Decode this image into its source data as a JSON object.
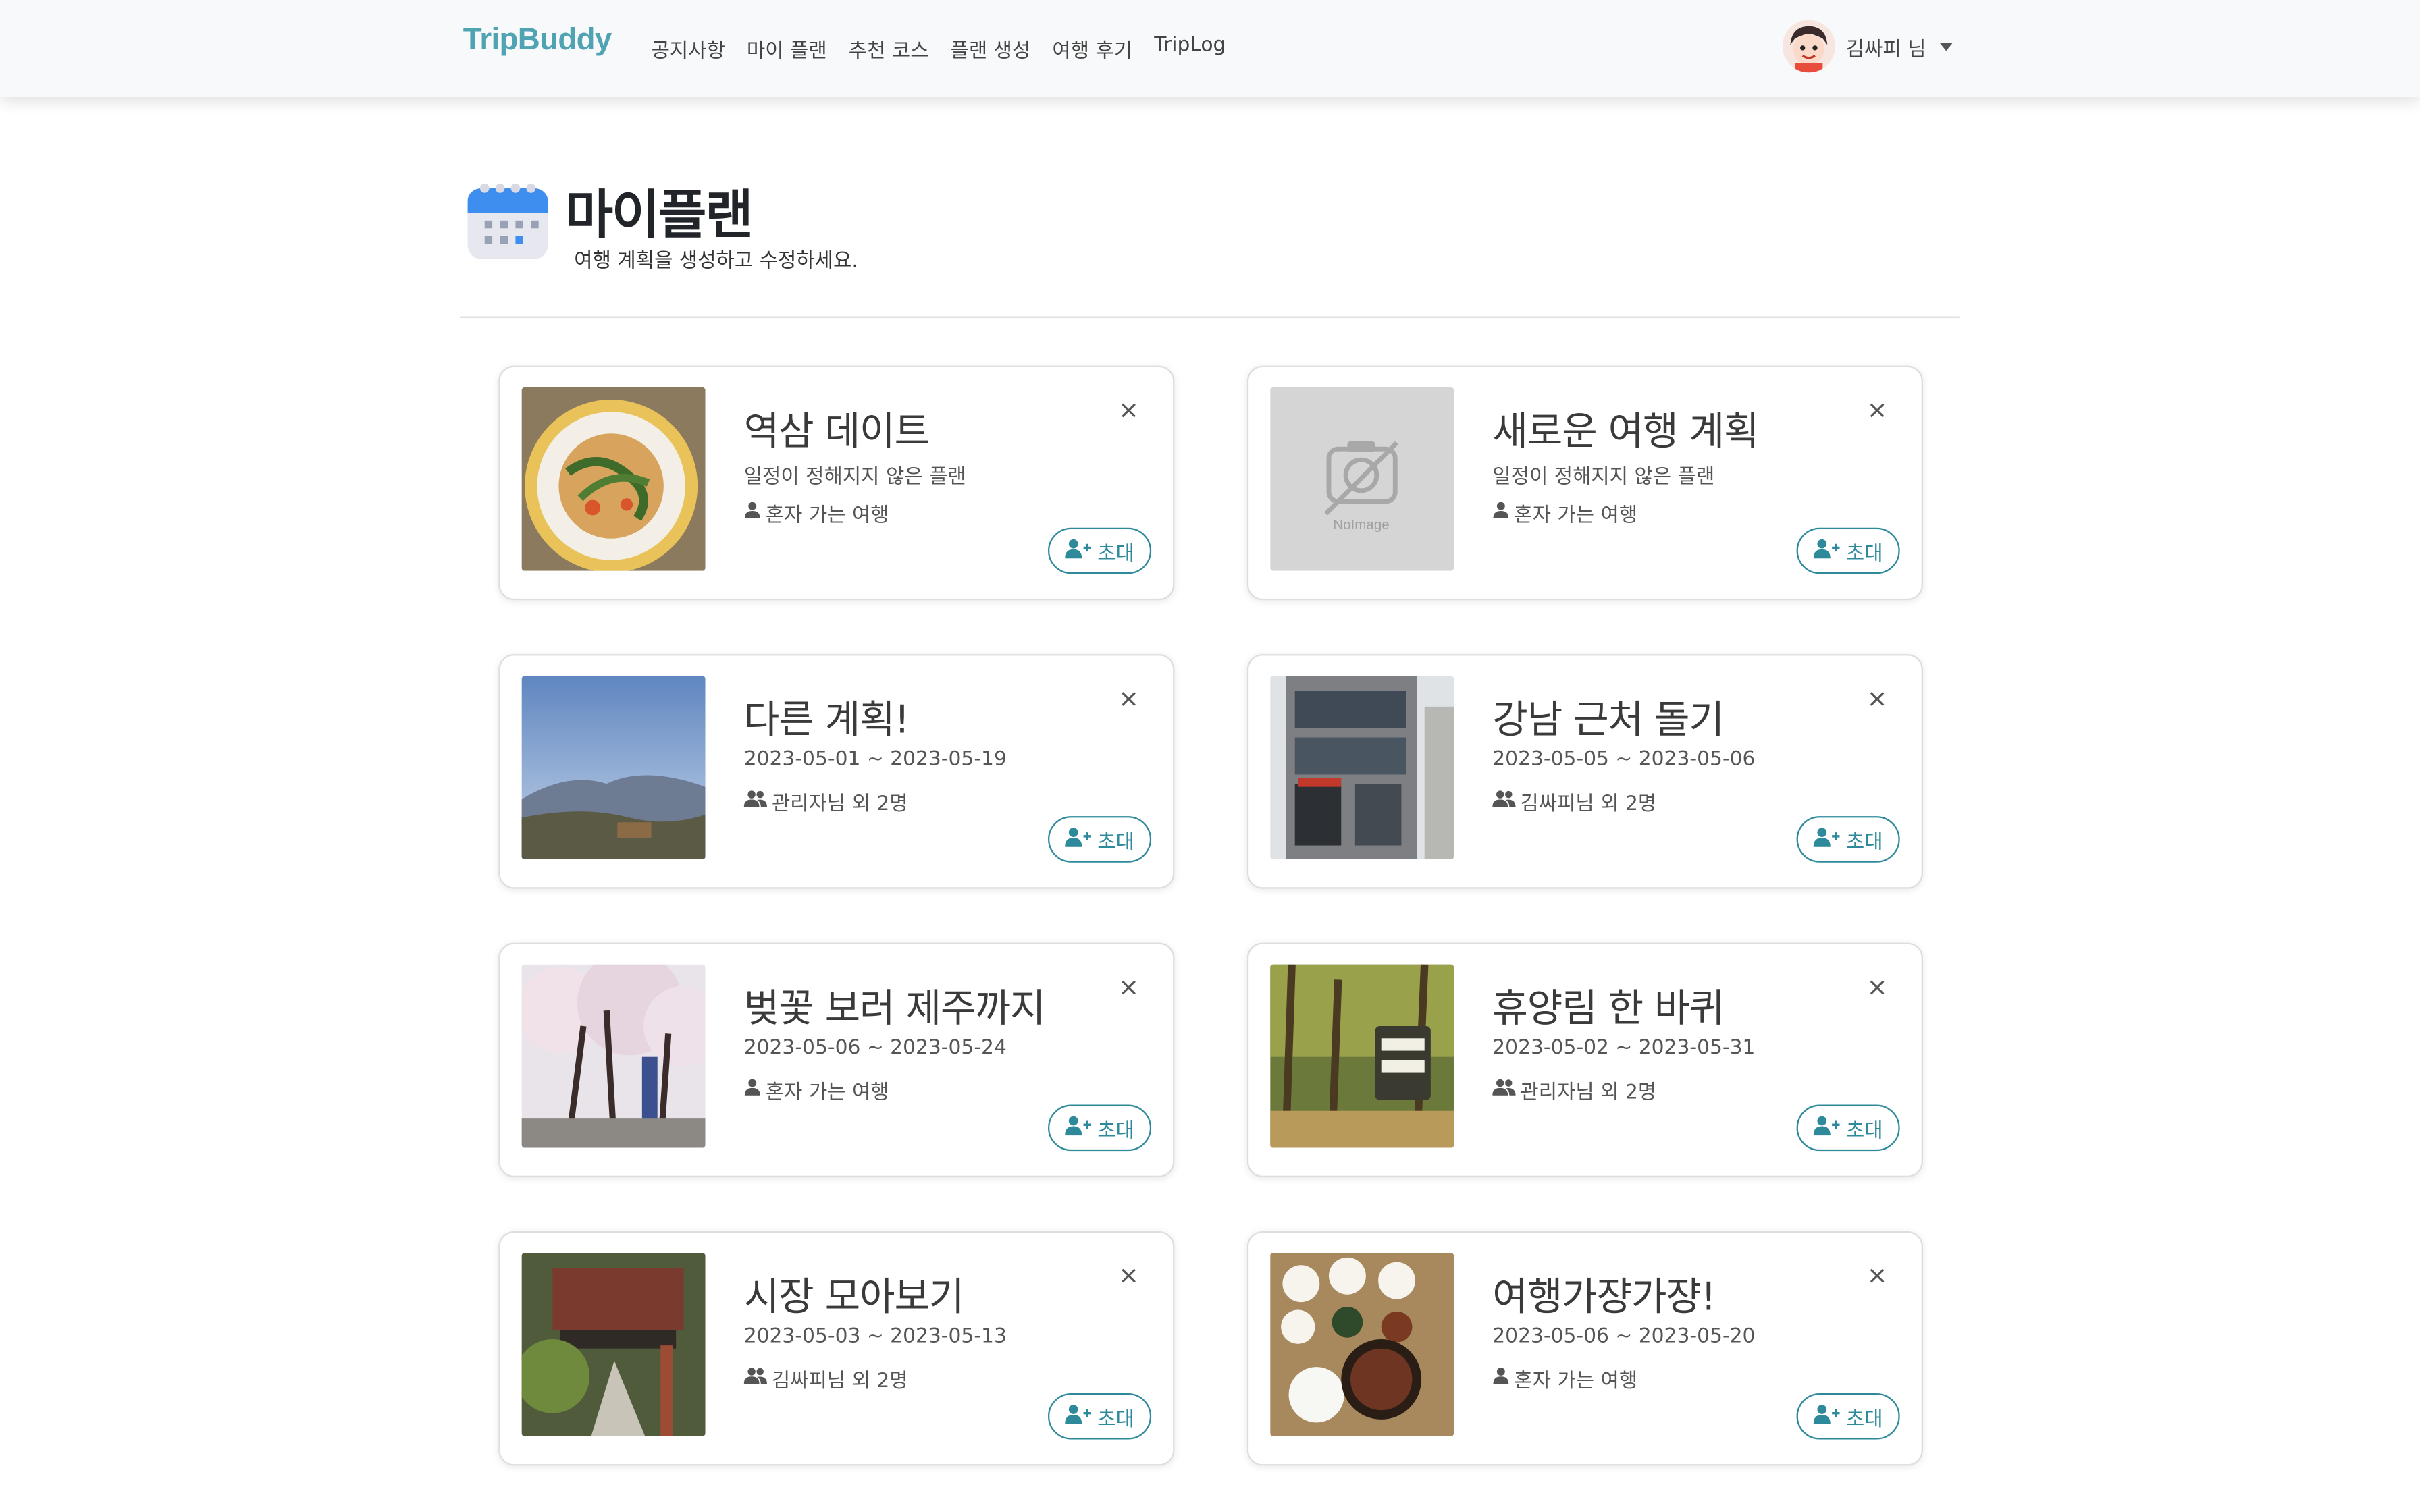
{
  "navbar": {
    "brand": "TripBuddy",
    "links": [
      "공지사항",
      "마이 플랜",
      "추천 코스",
      "플랜 생성",
      "여행 후기",
      "TripLog"
    ],
    "user_name": "김싸피 님"
  },
  "header": {
    "title": "마이플랜",
    "subtitle": "여행 계획을 생성하고 수정하세요."
  },
  "invite_label": "초대",
  "close_label": "×",
  "noimage_label": "NoImage",
  "plans": [
    {
      "title": "역삼 데이트",
      "dates": "일정이 정해지지 않은 플랜",
      "members": "혼자 가는 여행",
      "group": false,
      "image": "pasta"
    },
    {
      "title": "새로운 여행 계획",
      "dates": "일정이 정해지지 않은 플랜",
      "members": "혼자 가는 여행",
      "group": false,
      "image": "noimage"
    },
    {
      "title": "다른 계획!",
      "dates": "2023-05-01 ~ 2023-05-19",
      "members": "관리자님 외 2명",
      "group": true,
      "image": "mountain"
    },
    {
      "title": "강남 근처 돌기",
      "dates": "2023-05-05 ~ 2023-05-06",
      "members": "김싸피님 외 2명",
      "group": true,
      "image": "building"
    },
    {
      "title": "벚꽃 보러 제주까지",
      "dates": "2023-05-06 ~ 2023-05-24",
      "members": "혼자 가는 여행",
      "group": false,
      "image": "cherry"
    },
    {
      "title": "휴양림 한 바퀴",
      "dates": "2023-05-02 ~ 2023-05-31",
      "members": "관리자님 외 2명",
      "group": true,
      "image": "forest"
    },
    {
      "title": "시장 모아보기",
      "dates": "2023-05-03 ~ 2023-05-13",
      "members": "김싸피님 외 2명",
      "group": true,
      "image": "market"
    },
    {
      "title": "여행가쟝가쟝!",
      "dates": "2023-05-06 ~ 2023-05-20",
      "members": "혼자 가는 여행",
      "group": false,
      "image": "food"
    }
  ],
  "colors": {
    "brand": "#4fa3b2",
    "accent": "#2e8a9b"
  }
}
